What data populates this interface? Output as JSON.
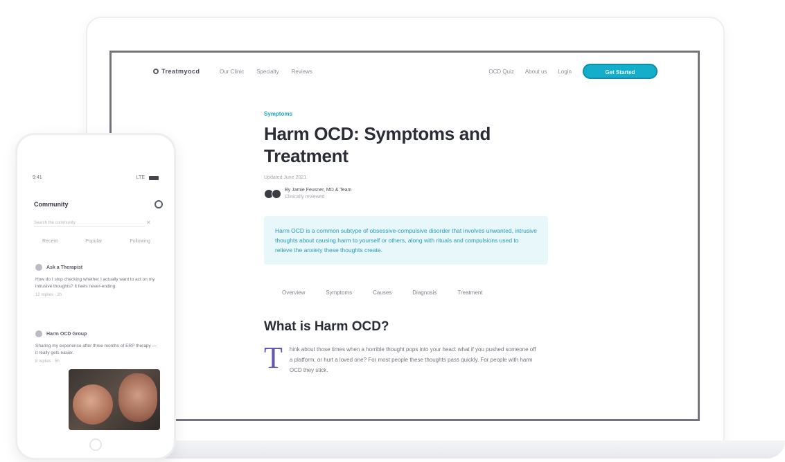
{
  "desktop": {
    "logo": "Treatmyocd",
    "nav_links": [
      "Our Clinic",
      "Specialty",
      "Reviews"
    ],
    "nav_right": [
      "OCD Quiz",
      "About us",
      "Login"
    ],
    "cta_label": "Get Started",
    "article": {
      "category": "Symptoms",
      "title": "Harm OCD: Symptoms and Treatment",
      "updated": "Updated June 2021",
      "author_name": "By Jamie Feusner, MD & Team",
      "author_sub": "Clinically reviewed",
      "summary": "Harm OCD is a common subtype of obsessive-compulsive disorder that involves unwanted, intrusive thoughts about causing harm to yourself or others, along with rituals and compulsions used to relieve the anxiety these thoughts create.",
      "toc": [
        "Overview",
        "Symptoms",
        "Causes",
        "Diagnosis",
        "Treatment"
      ],
      "section_heading": "What is Harm OCD?",
      "dropcap": "T",
      "body": "hink about those times when a horrible thought pops into your head: what if you pushed someone off a platform, or hurt a loved one? For most people these thoughts pass quickly. For people with harm OCD they stick."
    }
  },
  "phone": {
    "status_time": "9:41",
    "status_carrier": "LTE",
    "logo": "Community",
    "search_placeholder": "Search the community",
    "tabs": [
      "Recent",
      "Popular",
      "Following"
    ],
    "cards": [
      {
        "name": "Ask a Therapist",
        "body": "How do I stop checking whether I actually want to act on my intrusive thoughts? It feels never-ending.",
        "meta": "12 replies · 2h"
      },
      {
        "name": "Harm OCD Group",
        "body": "Sharing my experience after three months of ERP therapy — it really gets easier.",
        "meta": "8 replies · 5h"
      }
    ]
  },
  "colors": {
    "accent": "#15aeca",
    "summary_bg": "#e7f7fa",
    "dropcap": "#6656b0"
  }
}
